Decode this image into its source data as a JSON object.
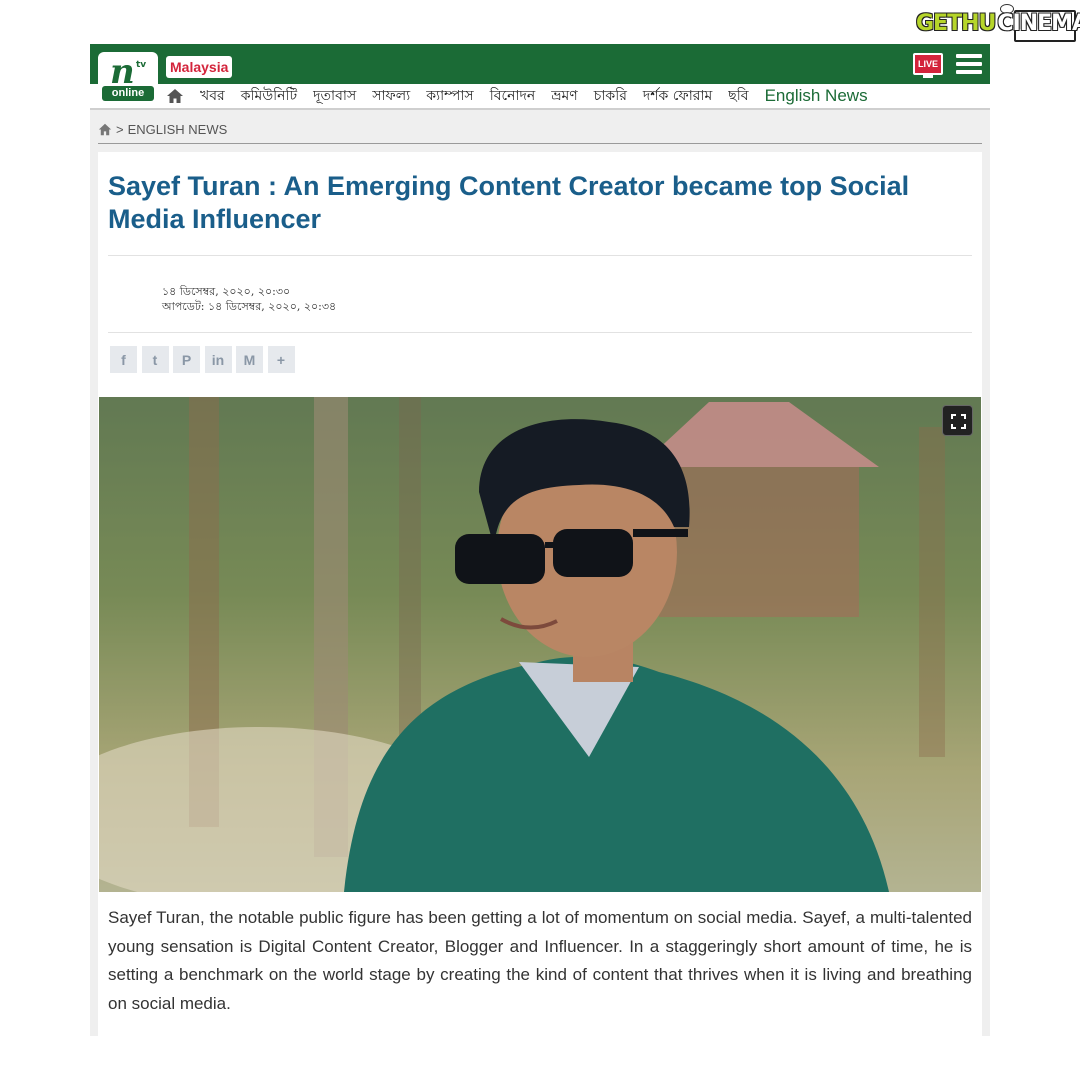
{
  "watermark": {
    "brand_first": "GETHU",
    "brand_second": "CINEMA"
  },
  "header": {
    "logo_mark": "n",
    "logo_sub": "tv",
    "logo_label": "online",
    "edition": "Malaysia",
    "live_label": "LIVE",
    "colors": {
      "primary": "#1b6b36",
      "live": "#d3243b"
    }
  },
  "nav": {
    "home_icon": "home-icon",
    "items": [
      "খবর",
      "কমিউনিটি",
      "দূতাবাস",
      "সাফল্য",
      "ক্যাম্পাস",
      "বিনোদন",
      "ভ্রমণ",
      "চাকরি",
      "দর্শক ফোরাম",
      "ছবি"
    ],
    "english": "English News"
  },
  "breadcrumb": {
    "separator": ">",
    "section": "ENGLISH NEWS"
  },
  "article": {
    "title": "Sayef Turan : An Emerging Content Creator became top Social Media Influencer",
    "published": "১৪ ডিসেম্বর, ২০২০, ২০:৩০",
    "updated": "আপডেট: ১৪ ডিসেম্বর, ২০২০, ২০:৩৪",
    "share_icons": [
      "facebook-icon",
      "twitter-icon",
      "pinterest-icon",
      "linkedin-icon",
      "email-icon",
      "more-icon"
    ],
    "share_glyphs": [
      "f",
      "t",
      "P",
      "in",
      "M",
      "+"
    ],
    "body": "Sayef Turan, the notable public figure has been getting a lot of momentum on social media. Sayef, a multi-talented young sensation is Digital Content Creator, Blogger and Influencer. In a staggeringly short amount of time, he is setting a benchmark on the world stage by creating the kind of content that thrives when it is living and breathing on social media."
  }
}
